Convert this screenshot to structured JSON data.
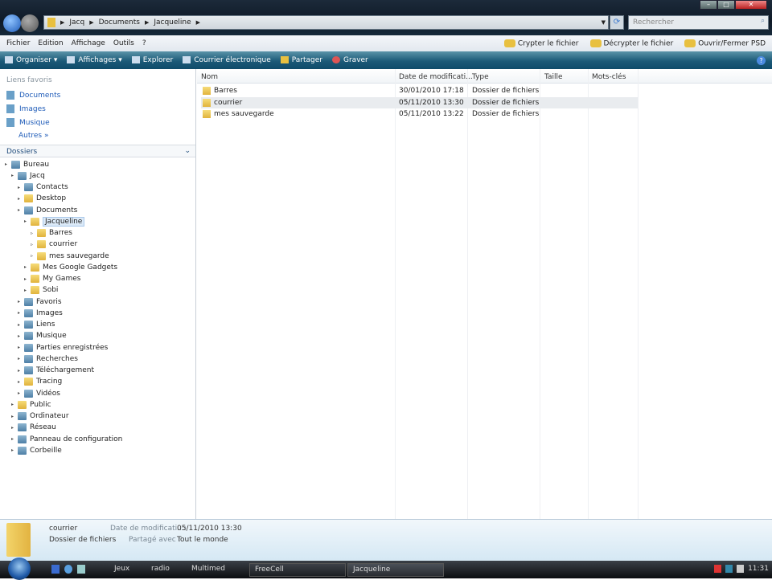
{
  "address": {
    "crumbs": [
      "Jacq",
      "Documents",
      "Jacqueline"
    ],
    "search_placeholder": "Rechercher"
  },
  "menu": {
    "items": [
      "Fichier",
      "Edition",
      "Affichage",
      "Outils",
      "?"
    ],
    "right": [
      "Crypter le fichier",
      "Décrypter le fichier",
      "Ouvrir/Fermer PSD"
    ]
  },
  "commands": [
    "Organiser ▾",
    "Affichages ▾",
    "Explorer",
    "Courrier électronique",
    "Partager",
    "Graver"
  ],
  "favorites": {
    "title": "Liens favoris",
    "items": [
      "Documents",
      "Images",
      "Musique"
    ],
    "more": "Autres »"
  },
  "folders": {
    "title": "Dossiers",
    "tree": [
      {
        "label": "Bureau",
        "level": 0,
        "sys": true
      },
      {
        "label": "Jacq",
        "level": 1,
        "sys": true
      },
      {
        "label": "Contacts",
        "level": 2,
        "sys": true
      },
      {
        "label": "Desktop",
        "level": 2
      },
      {
        "label": "Documents",
        "level": 2,
        "sys": true
      },
      {
        "label": "Jacqueline",
        "level": 3,
        "selected": true
      },
      {
        "label": "Barres",
        "level": 4
      },
      {
        "label": "courrier",
        "level": 4
      },
      {
        "label": "mes sauvegarde",
        "level": 4
      },
      {
        "label": "Mes Google Gadgets",
        "level": 3
      },
      {
        "label": "My Games",
        "level": 3
      },
      {
        "label": "Sobi",
        "level": 3
      },
      {
        "label": "Favoris",
        "level": 2,
        "sys": true
      },
      {
        "label": "Images",
        "level": 2,
        "sys": true
      },
      {
        "label": "Liens",
        "level": 2,
        "sys": true
      },
      {
        "label": "Musique",
        "level": 2,
        "sys": true
      },
      {
        "label": "Parties enregistrées",
        "level": 2,
        "sys": true
      },
      {
        "label": "Recherches",
        "level": 2,
        "sys": true
      },
      {
        "label": "Téléchargement",
        "level": 2,
        "sys": true
      },
      {
        "label": "Tracing",
        "level": 2
      },
      {
        "label": "Vidéos",
        "level": 2,
        "sys": true
      },
      {
        "label": "Public",
        "level": 1
      },
      {
        "label": "Ordinateur",
        "level": 1,
        "sys": true
      },
      {
        "label": "Réseau",
        "level": 1,
        "sys": true
      },
      {
        "label": "Panneau de configuration",
        "level": 1,
        "sys": true
      },
      {
        "label": "Corbeille",
        "level": 1,
        "sys": true
      }
    ]
  },
  "columns": [
    "Nom",
    "Date de modificati...",
    "Type",
    "Taille",
    "Mots-clés"
  ],
  "files": [
    {
      "name": "Barres",
      "date": "30/01/2010 17:18",
      "type": "Dossier de fichiers"
    },
    {
      "name": "courrier",
      "date": "05/11/2010 13:30",
      "type": "Dossier de fichiers",
      "selected": true
    },
    {
      "name": "mes sauvegarde",
      "date": "05/11/2010 13:22",
      "type": "Dossier de fichiers"
    }
  ],
  "details": {
    "name": "courrier",
    "kind": "Dossier de fichiers",
    "date_label": "Date de modificati...:",
    "date": "05/11/2010 13:30",
    "shared_label": "Partagé avec :",
    "shared": "Tout le monde"
  },
  "taskbar": {
    "toolbars": [
      "Jeux",
      "radio",
      "Multimed"
    ],
    "windows": [
      "FreeCell",
      "Jacqueline"
    ],
    "clock": "11:31"
  }
}
